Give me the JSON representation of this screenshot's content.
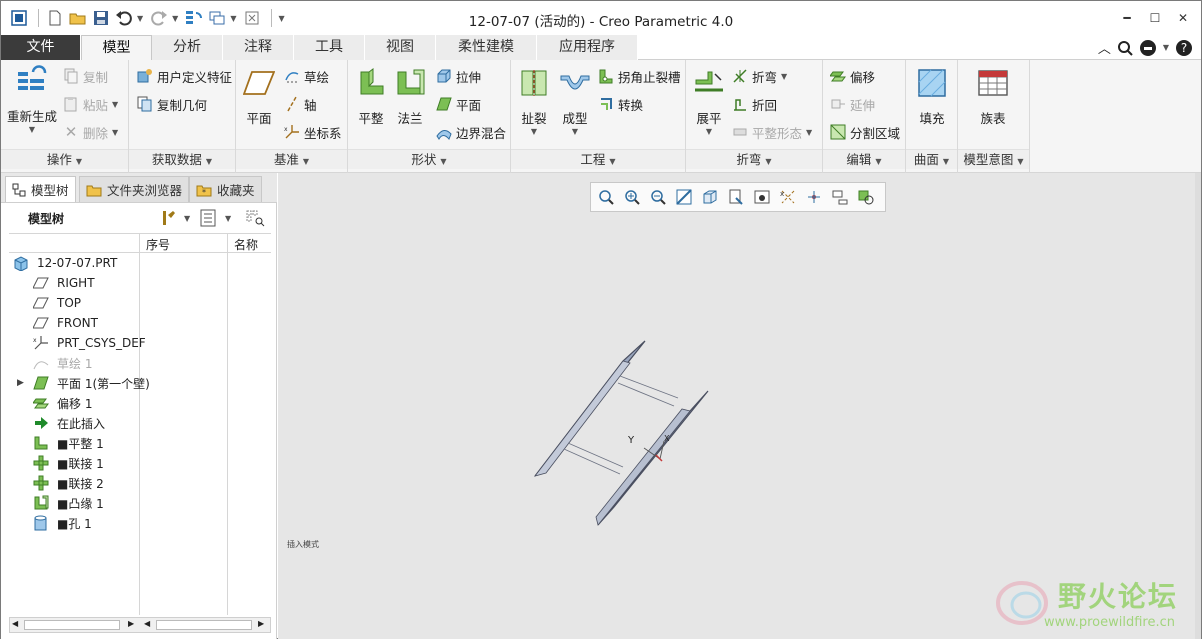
{
  "window": {
    "title": "12-07-07 (活动的) - Creo Parametric 4.0"
  },
  "quick_access": [
    "app-icon",
    "new-icon",
    "open-icon",
    "save-icon",
    "undo-icon",
    "redo-icon",
    "regenerate-icon",
    "windows-icon",
    "close-window-icon",
    "customize-icon"
  ],
  "tabs": [
    "文件",
    "模型",
    "分析",
    "注释",
    "工具",
    "视图",
    "柔性建模",
    "应用程序"
  ],
  "active_tab": "模型",
  "ribbon": {
    "operations": {
      "label": "操作",
      "regenerate": "重新生成",
      "copy": "复制",
      "paste": "粘贴",
      "delete": "删除"
    },
    "get_data": {
      "label": "获取数据",
      "udf": "用户定义特征",
      "copy_geom": "复制几何"
    },
    "datum": {
      "label": "基准",
      "plane": "平面",
      "sketch": "草绘",
      "axis": "轴",
      "csys": "坐标系"
    },
    "shapes": {
      "label": "形状",
      "flat": "平整",
      "flange": "法兰",
      "extrude": "拉伸",
      "planar": "平面",
      "boundary_blend": "边界混合"
    },
    "engineering": {
      "label": "工程",
      "rip": "扯裂",
      "form": "成型",
      "corner_relief": "拐角止裂槽",
      "convert": "转换"
    },
    "bends": {
      "label": "折弯",
      "unbend": "展平",
      "bend": "折弯",
      "bend_back": "折回",
      "flat_state": "平整形态"
    },
    "editing": {
      "label": "编辑",
      "offset": "偏移",
      "extend": "延伸",
      "split_area": "分割区域"
    },
    "surfaces": {
      "label": "曲面",
      "fill": "填充"
    },
    "model_intent": {
      "label": "模型意图",
      "family_table": "族表"
    }
  },
  "panel": {
    "tabs": [
      "模型树",
      "文件夹浏览器",
      "收藏夹"
    ],
    "header": "模型树",
    "columns": [
      "序号",
      "名称"
    ],
    "nodes": [
      {
        "label": "12-07-07.PRT",
        "icon": "part-icon",
        "dim": false
      },
      {
        "label": "RIGHT",
        "icon": "datum-plane-icon",
        "dim": false
      },
      {
        "label": "TOP",
        "icon": "datum-plane-icon",
        "dim": false
      },
      {
        "label": "FRONT",
        "icon": "datum-plane-icon",
        "dim": false
      },
      {
        "label": "PRT_CSYS_DEF",
        "icon": "csys-icon",
        "dim": false
      },
      {
        "label": "草绘 1",
        "icon": "sketch-icon",
        "dim": true
      },
      {
        "label": "平面 1(第一个壁)",
        "icon": "planar-wall-icon",
        "dim": false
      },
      {
        "label": "偏移 1",
        "icon": "offset-icon",
        "dim": false
      },
      {
        "label": "在此插入",
        "icon": "insert-here-icon",
        "dim": false
      },
      {
        "label": "■平整 1",
        "icon": "flat-wall-icon",
        "dim": false
      },
      {
        "label": "■联接 1",
        "icon": "joint-icon",
        "dim": false
      },
      {
        "label": "■联接 2",
        "icon": "joint-icon",
        "dim": false
      },
      {
        "label": "■凸缘 1",
        "icon": "flange-icon",
        "dim": false
      },
      {
        "label": "■孔 1",
        "icon": "hole-icon",
        "dim": false
      }
    ]
  },
  "graphics": {
    "status_text": "插入模式",
    "axis_label_y": "Y",
    "axis_label_x": "X",
    "watermark_cn": "野火论坛",
    "watermark_url": "www.proewildfire.cn",
    "accent": "#1a6fb5",
    "model_fill": "#9aa6be",
    "model_edge": "#4a4f60"
  }
}
